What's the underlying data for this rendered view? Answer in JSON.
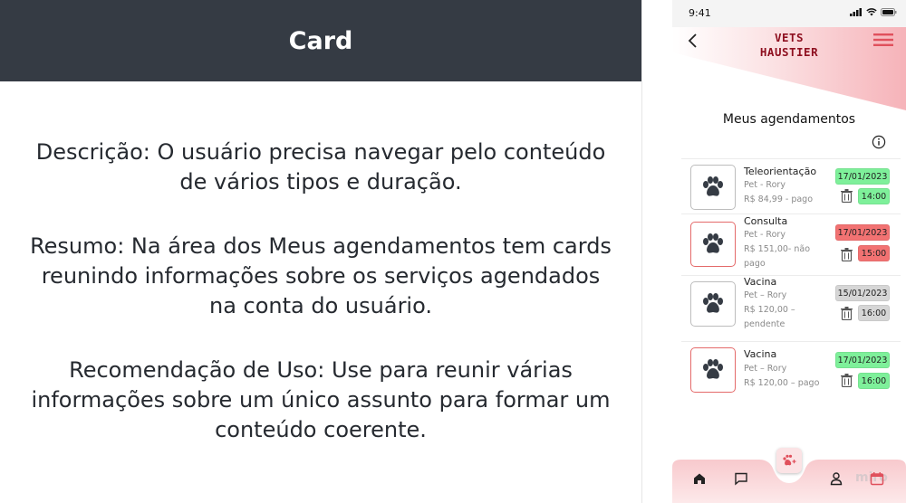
{
  "left_panel": {
    "header_title": "Card",
    "descricao": "Descrição: O usuário precisa navegar pelo conteúdo de vários tipos e duração.",
    "resumo": "Resumo: Na área dos Meus agendamentos tem cards reunindo informações sobre os serviços agendados na conta do usuário.",
    "recomendacao": "Recomendação de Uso: Use para reunir várias informações sobre um único assunto para formar um conteúdo coerente."
  },
  "phone": {
    "status_time": "9:41",
    "brand_line1": "VETS",
    "brand_line2": "HAUSTIER",
    "page_heading": "Meus agendamentos",
    "appointments": [
      {
        "title": "Teleorientação",
        "pet": "Pet -  Rory",
        "price": "R$ 84,99 - pago",
        "price_line2": "",
        "date": "17/01/2023",
        "time": "14:00",
        "status": "pago",
        "badge_color": "#7ef09a"
      },
      {
        "title": "Consulta",
        "pet": "Pet -  Rory",
        "price": "R$ 151,00- não",
        "price_line2": "pago",
        "date": "17/01/2023",
        "time": "15:00",
        "status": "não pago",
        "badge_color": "#f27272"
      },
      {
        "title": "Vacina",
        "pet": "Pet – Rory",
        "price": "R$ 120,00 –",
        "price_line2": "pendente",
        "date": "15/01/2023",
        "time": "16:00",
        "status": "pendente",
        "badge_color": "#d6d6d6"
      },
      {
        "title": "Vacina",
        "pet": "Pet – Rory",
        "price": "R$ 120,00 –  pago",
        "price_line2": "",
        "date": "17/01/2023",
        "time": "16:00",
        "status": "pago",
        "badge_color": "#7ef09a"
      }
    ],
    "nav_watermark": "miro",
    "icons": [
      "back-icon",
      "menu-icon",
      "info-icon",
      "paw-icon",
      "trash-icon",
      "home-icon",
      "chat-icon",
      "user-icon",
      "calendar-icon",
      "add-pet-icon"
    ],
    "colors": {
      "brand": "#8e0f1f",
      "accent_pink": "#f6b3b9",
      "header_dark": "#353b44"
    }
  }
}
